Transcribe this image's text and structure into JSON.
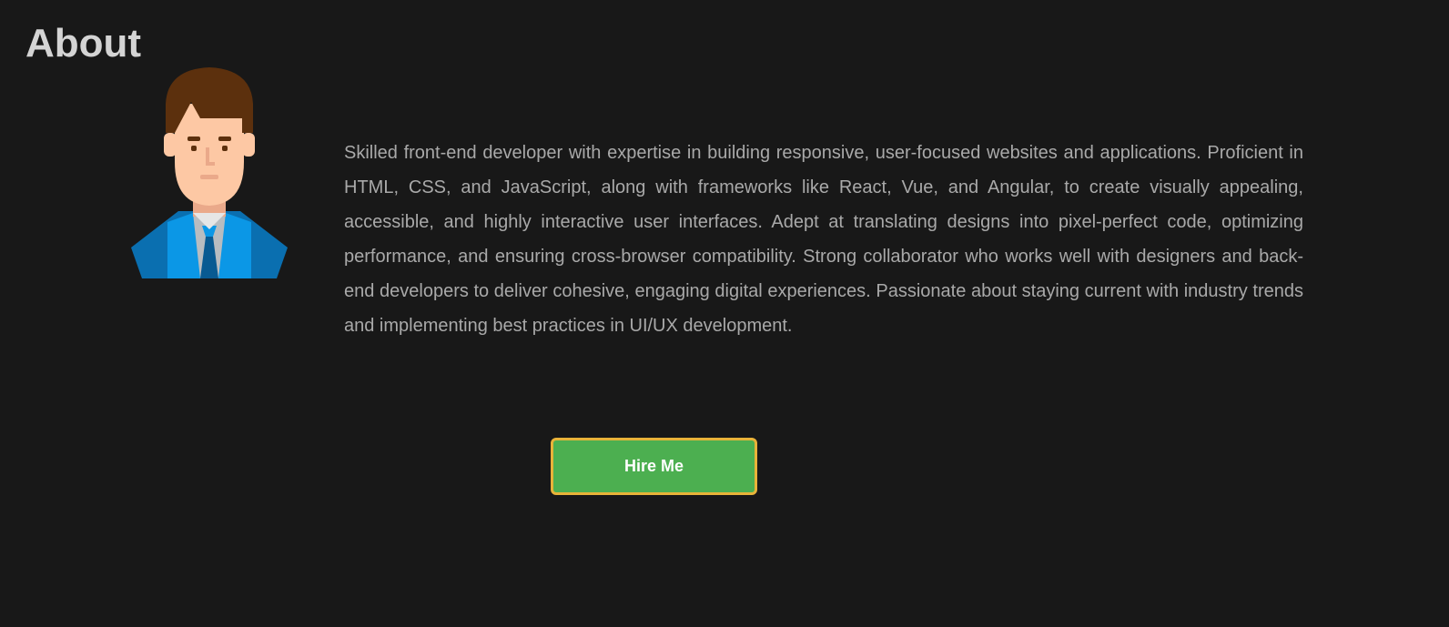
{
  "about": {
    "title": "About",
    "bio": "Skilled front-end developer with expertise in building responsive, user-focused websites and applications. Proficient in HTML, CSS, and JavaScript, along with frameworks like React, Vue, and Angular, to create visually appealing, accessible, and highly interactive user interfaces. Adept at translating designs into pixel-perfect code, optimizing performance, and ensuring cross-browser compatibility. Strong collaborator who works well with designers and back-end developers to deliver cohesive, engaging digital experiences. Passionate about staying current with industry trends and implementing best practices in UI/UX development.",
    "avatar_icon": "developer-avatar-icon",
    "hire_label": "Hire Me"
  },
  "colors": {
    "background": "#181818",
    "title": "#d4d4d4",
    "text": "#a9a9a9",
    "button": "#4caf50",
    "button_border": "#e8b339"
  }
}
